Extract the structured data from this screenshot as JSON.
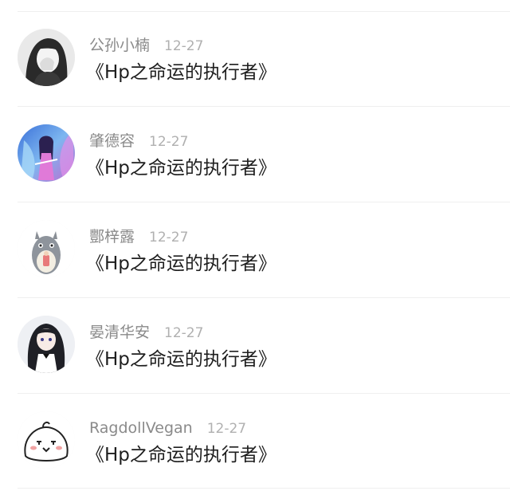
{
  "comments": [
    {
      "name": "公孙小楠",
      "time": "12-27",
      "text": "《Hp之命运的执行者》",
      "avatar_icon": "girl-hand-over-face-avatar"
    },
    {
      "name": "肇德容",
      "time": "12-27",
      "text": "《Hp之命运的执行者》",
      "avatar_icon": "anime-character-blue-pink-avatar"
    },
    {
      "name": "酆梓露",
      "time": "12-27",
      "text": "《Hp之命运的执行者》",
      "avatar_icon": "totoro-avatar"
    },
    {
      "name": "晏清华安",
      "time": "12-27",
      "text": "《Hp之命运的执行者》",
      "avatar_icon": "anime-girl-black-hair-avatar"
    },
    {
      "name": "RagdollVegan",
      "time": "12-27",
      "text": "《Hp之命运的执行者》",
      "avatar_icon": "cute-bun-face-avatar"
    }
  ],
  "colors": {
    "name": "#8a8a8a",
    "time": "#b0b0b0",
    "comment": "#1e1e1e",
    "divider": "#efefef"
  }
}
